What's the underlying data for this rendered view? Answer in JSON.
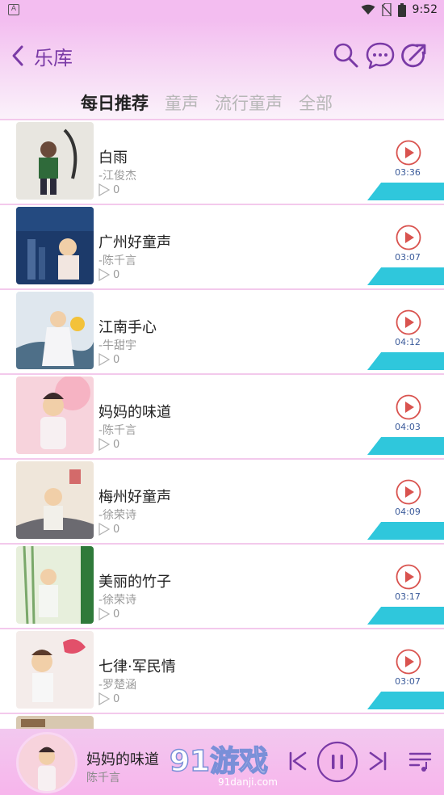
{
  "status_bar": {
    "time": "9:52",
    "icons": [
      "app-notification-icon",
      "wifi-icon",
      "no-sim-icon",
      "battery-icon"
    ]
  },
  "header": {
    "title": "乐库",
    "icons": [
      "back-arrow-icon",
      "search-icon",
      "message-icon",
      "share-icon"
    ]
  },
  "tabs": [
    {
      "label": "每日推荐",
      "active": true
    },
    {
      "label": "童声",
      "active": false
    },
    {
      "label": "流行童声",
      "active": false
    },
    {
      "label": "全部",
      "active": false
    }
  ],
  "songs": [
    {
      "title": "白雨",
      "artist": "-江俊杰",
      "plays": "0",
      "duration": "03:36"
    },
    {
      "title": "广州好童声",
      "artist": "-陈千言",
      "plays": "0",
      "duration": "03:07"
    },
    {
      "title": "江南手心",
      "artist": "-牛甜宇",
      "plays": "0",
      "duration": "04:12"
    },
    {
      "title": "妈妈的味道",
      "artist": "-陈千言",
      "plays": "0",
      "duration": "04:03"
    },
    {
      "title": "梅州好童声",
      "artist": "-徐荣诗",
      "plays": "0",
      "duration": "04:09"
    },
    {
      "title": "美丽的竹子",
      "artist": "-徐荣诗",
      "plays": "0",
      "duration": "03:17"
    },
    {
      "title": "七律·军民情",
      "artist": "-罗楚涵",
      "plays": "0",
      "duration": "03:07"
    }
  ],
  "now_playing": {
    "title": "妈妈的味道",
    "artist": "陈千言"
  },
  "watermark": {
    "brand": "91游戏",
    "url": "91danji.com"
  },
  "colors": {
    "accent_purple": "#7a3aa6",
    "play_red": "#d9534f",
    "accent_cyan": "#2fc7dc",
    "header_pink": "#f3bdf0"
  }
}
